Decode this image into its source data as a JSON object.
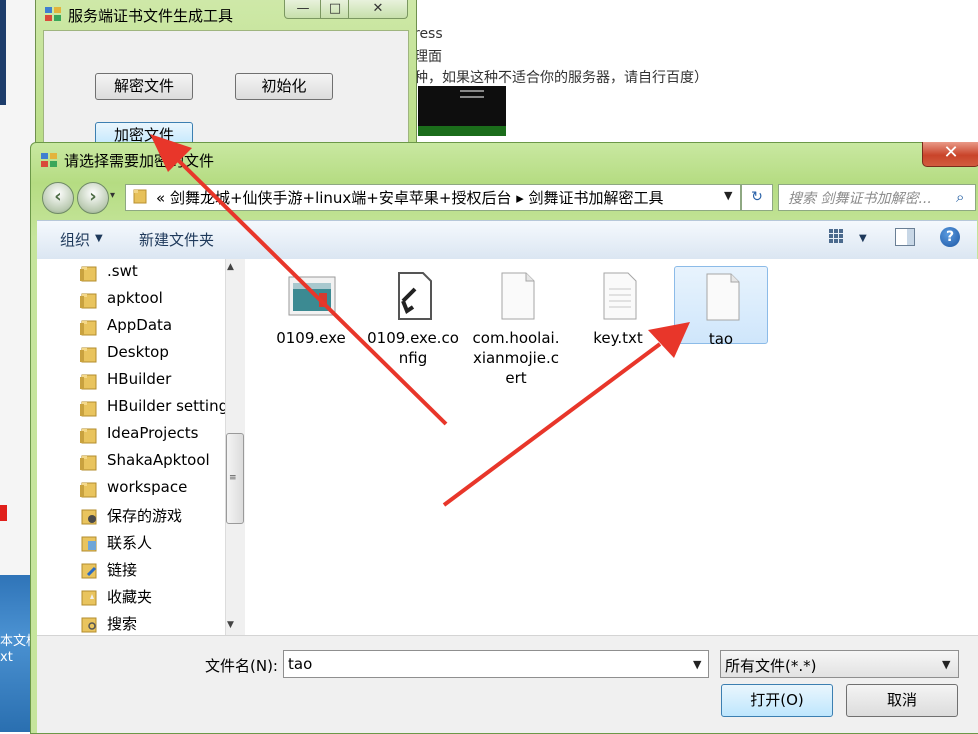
{
  "background": {
    "page_lines": [
      "ress",
      "理面",
      "种，如果这种不适合你的服务器，请自行百度）"
    ],
    "desktop_labels": [
      "本文档",
      "xt"
    ]
  },
  "tool_window": {
    "title": "服务端证书文件生成工具",
    "minimize": "—",
    "maximize": "□",
    "close": "✕",
    "buttons": {
      "decrypt": "解密文件",
      "init": "初始化",
      "encrypt": "加密文件"
    }
  },
  "dialog": {
    "title": "请选择需要加密的文件",
    "close": "✕",
    "nav": {
      "back": "‹",
      "forward": "›",
      "history": "▾"
    },
    "address": "«  剑舞龙城+仙侠手游+linux端+安卓苹果+授权后台  ▸  剑舞证书加解密工具",
    "address_drop": "▼",
    "refresh": "↻",
    "search_placeholder": "搜索 剑舞证书加解密...",
    "search_icon": "⌕",
    "toolbar": {
      "organize": "组织",
      "organize_caret": "▼",
      "new_folder": "新建文件夹",
      "view_caret": "▼",
      "help": "?"
    },
    "tree": [
      {
        "label": ".swt",
        "icon": "folder-icon"
      },
      {
        "label": "apktool",
        "icon": "folder-icon"
      },
      {
        "label": "AppData",
        "icon": "folder-icon"
      },
      {
        "label": "Desktop",
        "icon": "folder-icon"
      },
      {
        "label": "HBuilder",
        "icon": "folder-icon"
      },
      {
        "label": "HBuilder setting",
        "icon": "folder-icon"
      },
      {
        "label": "IdeaProjects",
        "icon": "folder-icon"
      },
      {
        "label": "ShakaApktool",
        "icon": "folder-icon"
      },
      {
        "label": "workspace",
        "icon": "folder-icon"
      },
      {
        "label": "保存的游戏",
        "icon": "saved-games-icon"
      },
      {
        "label": "联系人",
        "icon": "contacts-icon"
      },
      {
        "label": "链接",
        "icon": "links-icon"
      },
      {
        "label": "收藏夹",
        "icon": "favorites-icon"
      },
      {
        "label": "搜索",
        "icon": "searches-icon"
      }
    ],
    "scroll": {
      "up": "▲",
      "down": "▼",
      "grip": "≡"
    },
    "files": [
      {
        "name": "0109.exe",
        "icon": "exe-icon",
        "selected": false
      },
      {
        "name": "0109.exe.config",
        "icon": "config-file-icon",
        "selected": false
      },
      {
        "name": "com.hoolai.xianmojie.cert",
        "icon": "blank-file-icon",
        "selected": false
      },
      {
        "name": "key.txt",
        "icon": "text-file-icon",
        "selected": false
      },
      {
        "name": "tao",
        "icon": "blank-file-icon",
        "selected": true
      }
    ],
    "filename_label": "文件名(N):",
    "filename_value": "tao",
    "filename_drop": "▼",
    "filetype_value": "所有文件(*.*)",
    "filetype_drop": "▼",
    "open_button": "打开(O)",
    "cancel_button": "取消"
  },
  "colors": {
    "annotation_arrow": "#e8362a",
    "dialog_frame": "#b5dc82",
    "selection": "#cfe6fb"
  }
}
